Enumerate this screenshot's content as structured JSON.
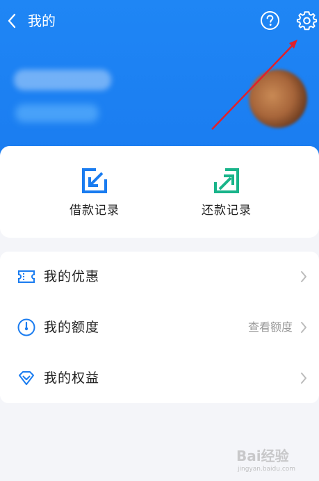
{
  "header": {
    "title": "我的",
    "back_icon": "chevron-left-icon",
    "help_icon": "question-circle-icon",
    "settings_icon": "gear-icon",
    "background_color": "#1a7cf0"
  },
  "records": {
    "items": [
      {
        "label": "借款记录",
        "icon": "borrow-record-icon",
        "color": "#1a7cf0"
      },
      {
        "label": "还款记录",
        "icon": "repay-record-icon",
        "color": "#19b48a"
      }
    ]
  },
  "menu": {
    "items": [
      {
        "label": "我的优惠",
        "icon": "coupon-icon",
        "value": ""
      },
      {
        "label": "我的额度",
        "icon": "gauge-icon",
        "value": "查看额度"
      },
      {
        "label": "我的权益",
        "icon": "diamond-icon",
        "value": ""
      }
    ]
  },
  "watermark": {
    "text": "Bai经验",
    "sub": "jingyan.baidu.com"
  }
}
